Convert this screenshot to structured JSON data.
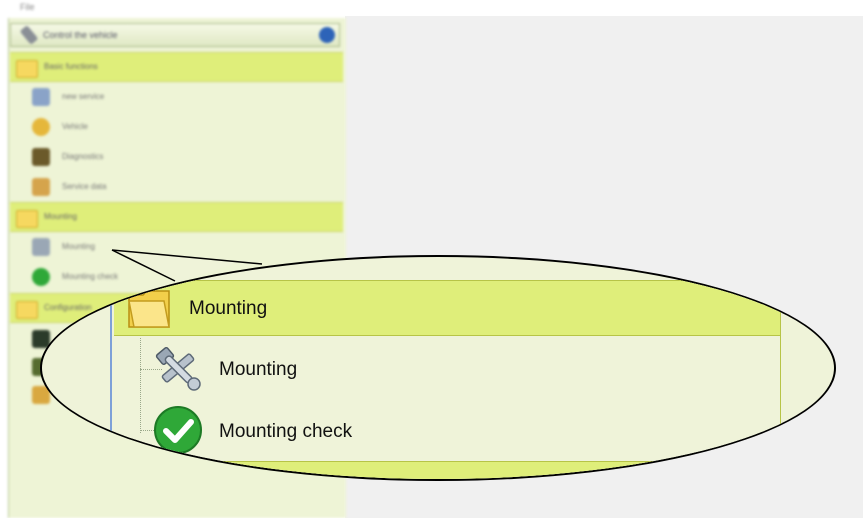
{
  "menubar": {
    "label": "File"
  },
  "sidebar": {
    "title": "Control the vehicle",
    "sections": [
      {
        "header": "Basic functions",
        "items": [
          {
            "label": "new service",
            "icon": "document-gear-icon",
            "color": "#8aa3c8"
          },
          {
            "label": "Vehicle",
            "icon": "vehicle-icon",
            "color": "#e5b73b"
          },
          {
            "label": "Diagnostics",
            "icon": "toolbox-icon",
            "color": "#6b5a2a"
          },
          {
            "label": "Service data",
            "icon": "checklist-icon",
            "color": "#d5a44c"
          }
        ]
      },
      {
        "header": "Mounting",
        "items": [
          {
            "label": "Mounting",
            "icon": "wrench-hammer-icon",
            "color": "#9aa7b5"
          },
          {
            "label": "Mounting check",
            "icon": "check-circle-icon",
            "color": "#2fa838"
          }
        ]
      },
      {
        "header": "Configuration",
        "items": [
          {
            "label": "",
            "icon": "monitor-icon",
            "color": "#2b3b2a"
          },
          {
            "label": "",
            "icon": "device-icon",
            "color": "#556b2f"
          },
          {
            "label": "",
            "icon": "key-icon",
            "color": "#d9a840"
          }
        ]
      }
    ]
  },
  "magnifier": {
    "header": "Mounting",
    "items": [
      {
        "label": "Mounting",
        "icon": "wrench-hammer-icon"
      },
      {
        "label": "Mounting check",
        "icon": "check-circle-icon"
      }
    ]
  },
  "colors": {
    "header_bg": "#dfee7a",
    "panel_bg": "#eff3d9",
    "content_bg": "#f0f0f0",
    "check_green": "#2fa838",
    "folder_yellow": "#f6d860"
  }
}
